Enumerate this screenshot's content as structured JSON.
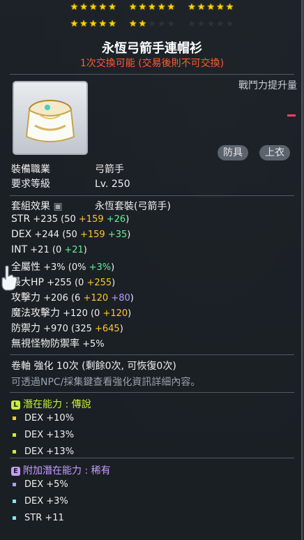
{
  "stars": {
    "row1": [
      5,
      5,
      5
    ],
    "row2_filled": 7,
    "row2_total": 15
  },
  "title": "永恆弓箭手連帽衫",
  "trade_note": "1次交換可能 (交易後則不可交換)",
  "combat_power_label": "戰鬥力提升量",
  "tags": [
    "防具",
    "上衣"
  ],
  "basic": {
    "job_label": "裝備職業",
    "job_value": "弓箭手",
    "level_label": "要求等級",
    "level_value": "Lv. 250"
  },
  "set": {
    "label": "套組效果",
    "value": "永恆套裝(弓箭手)"
  },
  "stats": [
    {
      "name": "STR",
      "total": "+235",
      "base": "50",
      "bonus": "+159",
      "extra": "+26",
      "extra_color": "green"
    },
    {
      "name": "DEX",
      "total": "+244",
      "base": "50",
      "bonus": "+159",
      "extra": "+35",
      "extra_color": "green"
    },
    {
      "name": "INT",
      "total": "+21",
      "base": "0",
      "bonus": "+21",
      "bonus_color": "green"
    },
    {
      "name": "全屬性",
      "total": "+3%",
      "base": "0%",
      "bonus": "+3%",
      "bonus_color": "green"
    },
    {
      "name": "最大HP",
      "total": "+255",
      "base": "0",
      "bonus": "+255"
    },
    {
      "name": "攻擊力",
      "total": "+206",
      "base": "6",
      "bonus": "+120",
      "extra": "+80",
      "extra_color": "purple"
    },
    {
      "name": "魔法攻擊力",
      "total": "+120",
      "base": "0",
      "bonus": "+120"
    },
    {
      "name": "防禦力",
      "total": "+970",
      "base": "325",
      "bonus": "+645"
    },
    {
      "name": "無視怪物防禦率",
      "total": "+5%"
    }
  ],
  "scroll_line": "卷軸 強化 10次 (剩餘0次, 可恢復0次)",
  "npc_note": "可透過NPC/採集鍵查看強化資訊詳細內容。",
  "potential": {
    "badge": "L",
    "label": "潛在能力 : 傳說",
    "color": "#c6f03a",
    "lines": [
      "DEX +10%",
      "DEX +13%",
      "DEX +13%"
    ],
    "dot_colors": [
      "#ffc928",
      "#c6f03a",
      "#c6f03a"
    ]
  },
  "additional": {
    "badge": "E",
    "label": "附加潛在能力 : 稀有",
    "color": "#c59cff",
    "lines": [
      "DEX +5%",
      "DEX +3%",
      "STR +11"
    ],
    "dot_colors": [
      "#b79cff",
      "#7fe7ff",
      "#7fe7ff"
    ]
  }
}
